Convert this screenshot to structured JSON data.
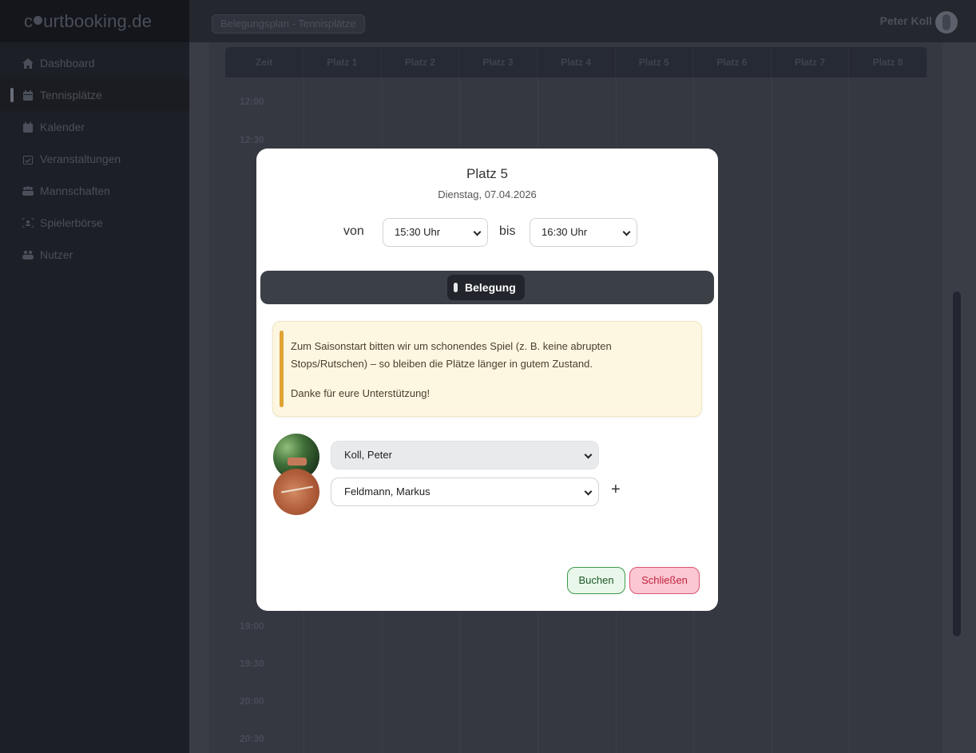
{
  "brand": {
    "pre": "c",
    "post": "urtbooking.de"
  },
  "sidebar": {
    "items": [
      {
        "label": "Dashboard",
        "icon": "home-icon"
      },
      {
        "label": "Tennisplätze",
        "icon": "calendar-grid-icon",
        "active": true
      },
      {
        "label": "Kalender",
        "icon": "calendar-icon"
      },
      {
        "label": "Veranstaltungen",
        "icon": "calendar-check-icon"
      },
      {
        "label": "Mannschaften",
        "icon": "team-icon"
      },
      {
        "label": "Spielerbörse",
        "icon": "player-scan-icon"
      },
      {
        "label": "Nutzer",
        "icon": "users-icon"
      }
    ]
  },
  "header": {
    "breadcrumb": "Belegungsplan - Tennisplätze",
    "user_name": "Peter Koll"
  },
  "schedule": {
    "columns": [
      "Zeit",
      "Platz 1",
      "Platz 2",
      "Platz 3",
      "Platz 4",
      "Platz 5",
      "Platz 6",
      "Platz 7",
      "Platz 8"
    ],
    "visible_times": {
      "t1200": "12:00",
      "t1230": "12:30",
      "t1900": "19:00",
      "t1930": "19:30",
      "t2000": "20:00",
      "t2030": "20:30"
    }
  },
  "modal": {
    "title": "Platz 5",
    "date": "Dienstag, 07.04.2026",
    "from_label": "von",
    "from_value": "15:30 Uhr",
    "to_label": "bis",
    "to_value": "16:30 Uhr",
    "tab_label": "Belegung",
    "notice": {
      "text": "Zum Saisonstart bitten wir um schonendes Spiel (z. B. keine abrupten Stops/Rutschen) – so bleiben die Plätze länger in gutem Zustand.",
      "thanks": "Danke für eure Unterstützung!"
    },
    "players": [
      "Koll, Peter",
      "Feldmann, Markus"
    ],
    "add_label": "+",
    "buttons": {
      "book": "Buchen",
      "close": "Schließen"
    }
  },
  "colors": {
    "book_green": "#3d9a4a",
    "close_red": "#d9566f",
    "notice_accent": "#e0a334"
  }
}
